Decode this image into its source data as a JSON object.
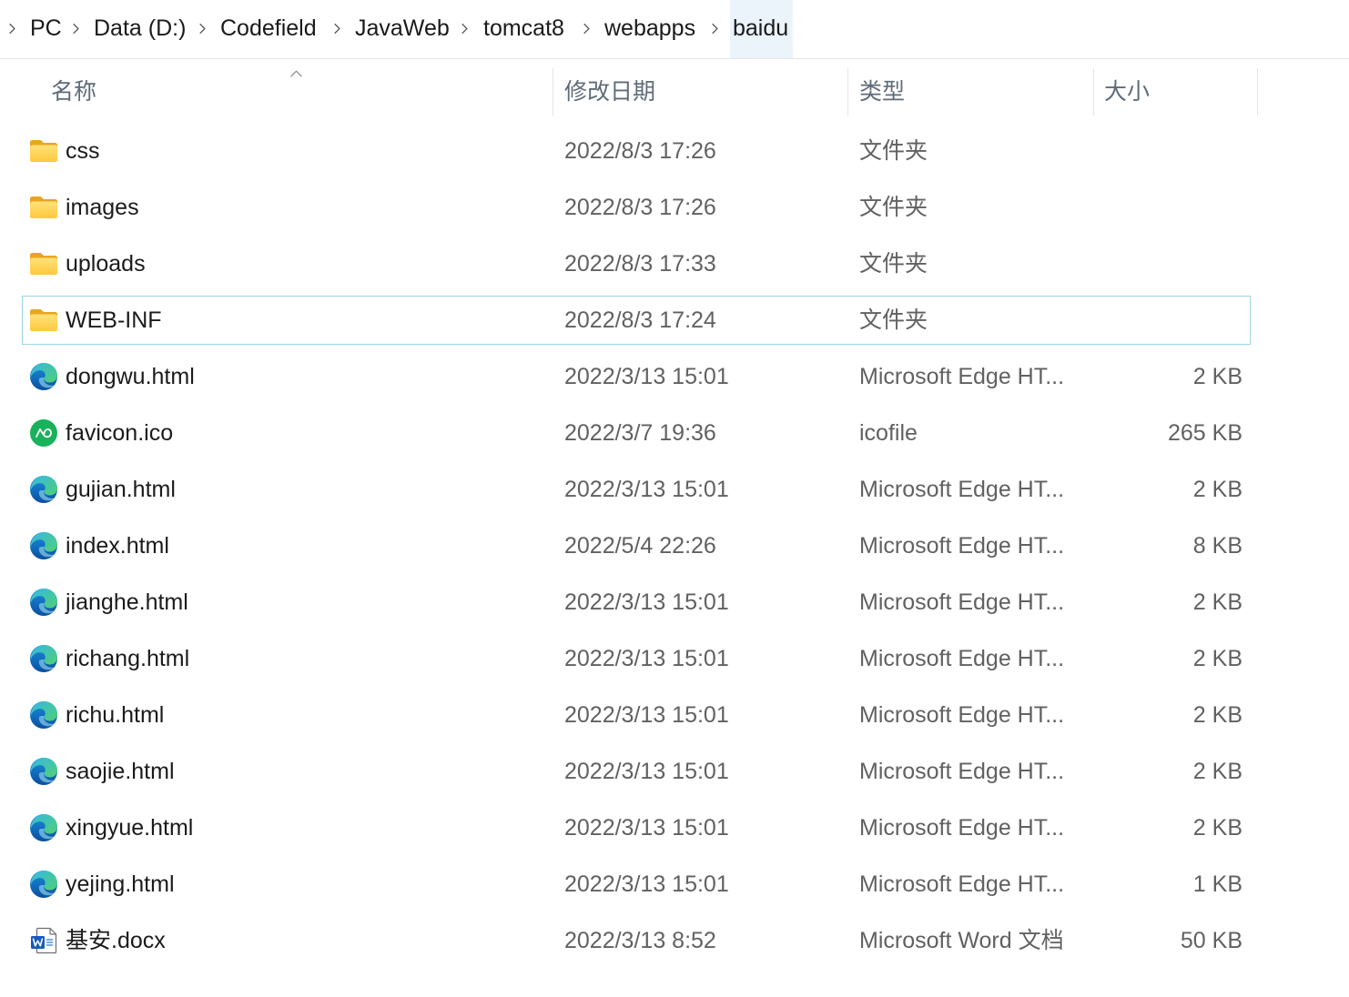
{
  "breadcrumb": {
    "items": [
      {
        "label": "PC"
      },
      {
        "label": "Data (D:)"
      },
      {
        "label": "Codefield"
      },
      {
        "label": "JavaWeb"
      },
      {
        "label": "tomcat8"
      },
      {
        "label": "webapps"
      },
      {
        "label": "baidu",
        "current": true
      }
    ],
    "separator_icon": "chevron-right-icon"
  },
  "columns": {
    "name": "名称",
    "modified": "修改日期",
    "type": "类型",
    "size": "大小",
    "sort_icon": "sort-ascending-icon"
  },
  "files": [
    {
      "name": "css",
      "modified": "2022/8/3 17:26",
      "type": "文件夹",
      "icon": "folder-icon"
    },
    {
      "name": "images",
      "modified": "2022/8/3 17:26",
      "type": "文件夹",
      "icon": "folder-icon"
    },
    {
      "name": "uploads",
      "modified": "2022/8/3 17:33",
      "type": "文件夹",
      "icon": "folder-icon"
    },
    {
      "name": "WEB-INF",
      "modified": "2022/8/3 17:24",
      "type": "文件夹",
      "icon": "folder-icon",
      "focused": true
    },
    {
      "name": "dongwu.html",
      "modified": "2022/3/13 15:01",
      "type": "Microsoft Edge HT...",
      "size": "2 KB",
      "icon": "edge-html-file-icon"
    },
    {
      "name": "favicon.ico",
      "modified": "2022/3/7 19:36",
      "type": "icofile",
      "size": "265 KB",
      "icon": "ico-file-icon"
    },
    {
      "name": "gujian.html",
      "modified": "2022/3/13 15:01",
      "type": "Microsoft Edge HT...",
      "size": "2 KB",
      "icon": "edge-html-file-icon"
    },
    {
      "name": "index.html",
      "modified": "2022/5/4 22:26",
      "type": "Microsoft Edge HT...",
      "size": "8 KB",
      "icon": "edge-html-file-icon"
    },
    {
      "name": "jianghe.html",
      "modified": "2022/3/13 15:01",
      "type": "Microsoft Edge HT...",
      "size": "2 KB",
      "icon": "edge-html-file-icon"
    },
    {
      "name": "richang.html",
      "modified": "2022/3/13 15:01",
      "type": "Microsoft Edge HT...",
      "size": "2 KB",
      "icon": "edge-html-file-icon"
    },
    {
      "name": "richu.html",
      "modified": "2022/3/13 15:01",
      "type": "Microsoft Edge HT...",
      "size": "2 KB",
      "icon": "edge-html-file-icon"
    },
    {
      "name": "saojie.html",
      "modified": "2022/3/13 15:01",
      "type": "Microsoft Edge HT...",
      "size": "2 KB",
      "icon": "edge-html-file-icon"
    },
    {
      "name": "xingyue.html",
      "modified": "2022/3/13 15:01",
      "type": "Microsoft Edge HT...",
      "size": "2 KB",
      "icon": "edge-html-file-icon"
    },
    {
      "name": "yejing.html",
      "modified": "2022/3/13 15:01",
      "type": "Microsoft Edge HT...",
      "size": "1 KB",
      "icon": "edge-html-file-icon"
    },
    {
      "name": "基安.docx",
      "modified": "2022/3/13 8:52",
      "type": "Microsoft Word 文档",
      "size": "50 KB",
      "icon": "word-document-icon"
    }
  ],
  "colors": {
    "focus_border": "#9fd4e3",
    "current_breadcrumb_bg": "#ebf3fb"
  }
}
